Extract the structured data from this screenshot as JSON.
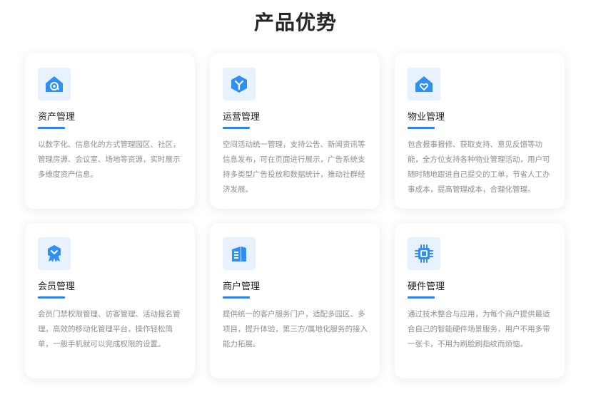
{
  "page": {
    "title": "产品优势"
  },
  "cards": [
    {
      "icon": "asset-home-icon",
      "title": "资产管理",
      "desc": "以数字化、信息化的方式管理园区、社区，管理房源、会议室、场地等资源，实时展示多维度资产信息。"
    },
    {
      "icon": "operation-hexagon-icon",
      "title": "运营管理",
      "desc": "空间活动统一管理，支持公告、新闻资讯等信息发布，可在页面进行展示，广告系统支持多类型广告投放和数据统计，推动社群经济发展。"
    },
    {
      "icon": "property-heart-home-icon",
      "title": "物业管理",
      "desc": "包含报事报修、获取支持、意见反馈等功能，全方位支持各种物业管理活动，用户可随时随地跟进自己提交的工单，节省人工办事成本，提高管理成本，合理化管理。"
    },
    {
      "icon": "member-badge-icon",
      "title": "会员管理",
      "desc": "会员门禁权限管理、访客管理、活动报名管理，高效的移动化管理平台，操作轻松简单，一般手机就可以完成权限的设置。"
    },
    {
      "icon": "merchant-building-icon",
      "title": "商户管理",
      "desc": "提供统一的客户服务门户，适配多园区、多项目，提升体验，第三方/属地化服务的接入能力拓展。"
    },
    {
      "icon": "hardware-chip-icon",
      "title": "硬件管理",
      "desc": "通过技术整合与应用，为每个商户提供最适合自己的智能硬件场景服务，用户不用多带一张卡，不用为刷脸刷指纹而烦恼。"
    }
  ],
  "colors": {
    "accent": "#1e8cf3",
    "icon_bg": "#e8f2fe",
    "title": "#262626",
    "desc": "#8e8e8e"
  }
}
